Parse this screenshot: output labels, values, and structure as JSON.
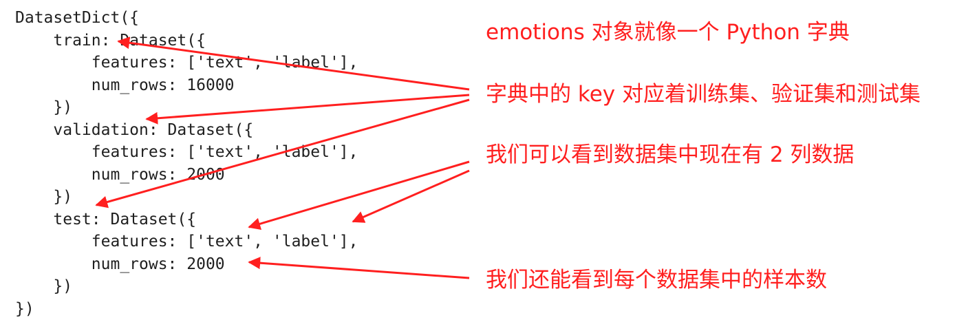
{
  "code_lines": [
    "DatasetDict({",
    "    train: Dataset({",
    "        features: ['text', 'label'],",
    "        num_rows: 16000",
    "    })",
    "    validation: Dataset({",
    "        features: ['text', 'label'],",
    "        num_rows: 2000",
    "    })",
    "    test: Dataset({",
    "        features: ['text', 'label'],",
    "        num_rows: 2000",
    "    })",
    "})"
  ],
  "annotations": [
    "emotions 对象就像一个 Python 字典",
    "字典中的 key 对应着训练集、验证集和测试集",
    "我们可以看到数据集中现在有 2 列数据",
    "我们还能看到每个数据集中的样本数"
  ],
  "colors": {
    "annotation": "#ff1f1f",
    "arrow": "#ff1f1f",
    "code_text": "#1f1f1f"
  }
}
